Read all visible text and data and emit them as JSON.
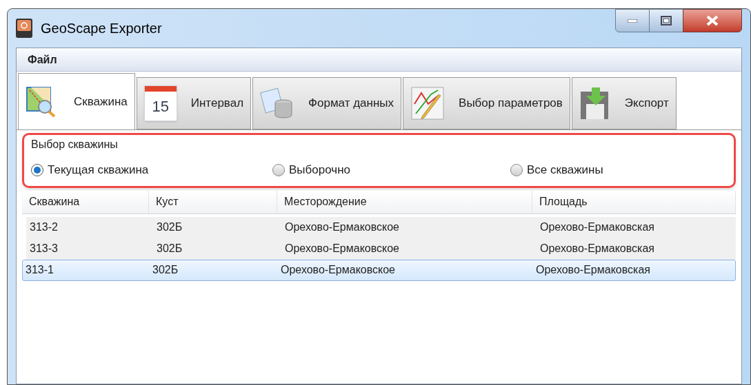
{
  "window": {
    "title": "GeoScape Exporter"
  },
  "menu": [
    "Файл"
  ],
  "tabs": [
    {
      "label": "Скважина",
      "selected": true,
      "kind": "map"
    },
    {
      "label": "Интервал",
      "selected": false,
      "kind": "calendar",
      "icon_text": "15"
    },
    {
      "label": "Формат данных",
      "selected": false,
      "kind": "database"
    },
    {
      "label": "Выбор параметров",
      "selected": false,
      "kind": "chart"
    },
    {
      "label": "Экспорт",
      "selected": false,
      "kind": "export"
    }
  ],
  "well_choice": {
    "title": "Выбор скважины",
    "options": [
      {
        "label": "Текущая скважина",
        "selected": true
      },
      {
        "label": "Выборочно",
        "selected": false
      },
      {
        "label": "Все скважины",
        "selected": false
      }
    ]
  },
  "table": {
    "columns": [
      "Скважина",
      "Куст",
      "Месторождение",
      "Площадь"
    ],
    "rows": [
      {
        "cells": [
          "313-2",
          "302Б",
          "Орехово-Ермаковское",
          "Орехово-Ермаковская"
        ],
        "selected": false
      },
      {
        "cells": [
          "313-3",
          "302Б",
          "Орехово-Ермаковское",
          "Орехово-Ермаковская"
        ],
        "selected": false
      },
      {
        "cells": [
          "313-1",
          "302Б",
          "Орехово-Ермаковское",
          "Орехово-Ермаковская"
        ],
        "selected": true
      }
    ]
  }
}
